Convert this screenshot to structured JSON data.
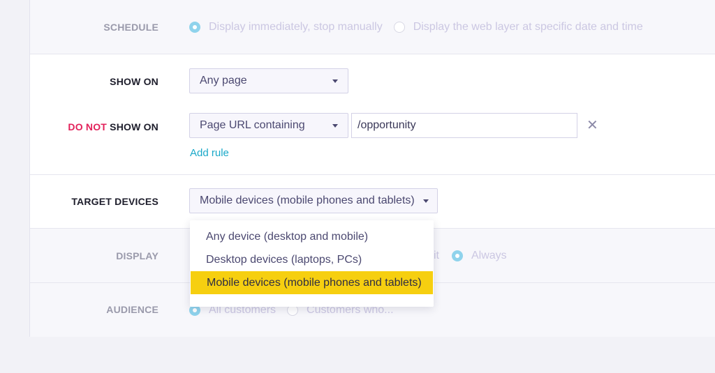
{
  "schedule": {
    "label": "SCHEDULE",
    "options": [
      {
        "label": "Display immediately, stop manually",
        "selected": true
      },
      {
        "label": "Display the web layer at specific date and time",
        "selected": false
      }
    ]
  },
  "show_on": {
    "label": "SHOW ON",
    "select_value": "Any page"
  },
  "do_not_show_on": {
    "label_accent": "DO NOT",
    "label_rest": " SHOW ON",
    "select_value": "Page URL containing",
    "input_value": "/opportunity",
    "remove_icon": "close-icon",
    "add_rule_label": "Add rule"
  },
  "target_devices": {
    "label": "TARGET DEVICES",
    "select_value": "Mobile devices (mobile phones and tablets)",
    "options": [
      {
        "label": "Any device (desktop and mobile)",
        "selected": false
      },
      {
        "label": "Desktop devices (laptops, PCs)",
        "selected": false
      },
      {
        "label": "Mobile devices (mobile phones and tablets)",
        "selected": true
      }
    ]
  },
  "display": {
    "label": "DISPLAY",
    "visible_partial_option": "sit",
    "options": [
      {
        "label": "Always",
        "selected": true
      }
    ]
  },
  "audience": {
    "label": "AUDIENCE",
    "options": [
      {
        "label": "All customers",
        "selected": true
      },
      {
        "label": "Customers who...",
        "selected": false
      }
    ]
  },
  "colors": {
    "accent": "#e2215a",
    "link": "#19a8c8",
    "highlight": "#f6cf10",
    "radio_on": "#8fd3ec"
  }
}
